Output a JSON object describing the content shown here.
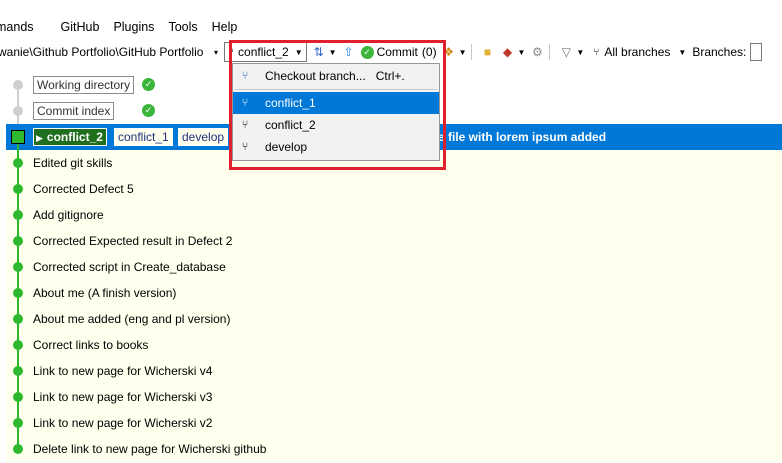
{
  "menu": [
    "mands",
    "GitHub",
    "Plugins",
    "Tools",
    "Help"
  ],
  "toolbar": {
    "repo_path": "wanie\\Github Portfolio\\GitHub Portfolio",
    "path_more": "▾",
    "current_branch": "conflict_2",
    "commit_label": "Commit",
    "commit_count": "(0)",
    "all_branches_label": "All branches",
    "branches_label": "Branches:"
  },
  "rows": {
    "working_directory": "Working directory",
    "commit_index": "Commit index",
    "selected": {
      "head_branch": "conflict_2",
      "ref1": "conflict_1",
      "ref2": "develop",
      "message": "e file with lorem ipsum added"
    },
    "commits": [
      "Edited git skills",
      "Corrected Defect 5",
      "Add gitignore",
      "Corrected Expected result in Defect 2",
      "Corrected script in Create_database",
      "About me (A finish version)",
      "About me added (eng and pl version)",
      "Correct links to books",
      "Link to new page for Wicherski v4",
      "Link to new page for Wicherski v3",
      "Link to new page for Wicherski v2",
      "Delete link to new page for Wicherski github"
    ]
  },
  "dropdown": {
    "checkout_label": "Checkout branch...",
    "checkout_shortcut": "Ctrl+.",
    "branches": [
      "conflict_1",
      "conflict_2",
      "develop"
    ],
    "active_index": 0
  },
  "colors": {
    "selection": "#0078d7",
    "graph_green": "#2db82d",
    "highlight": "#e0202c",
    "commit_bg": "#ffffee"
  }
}
